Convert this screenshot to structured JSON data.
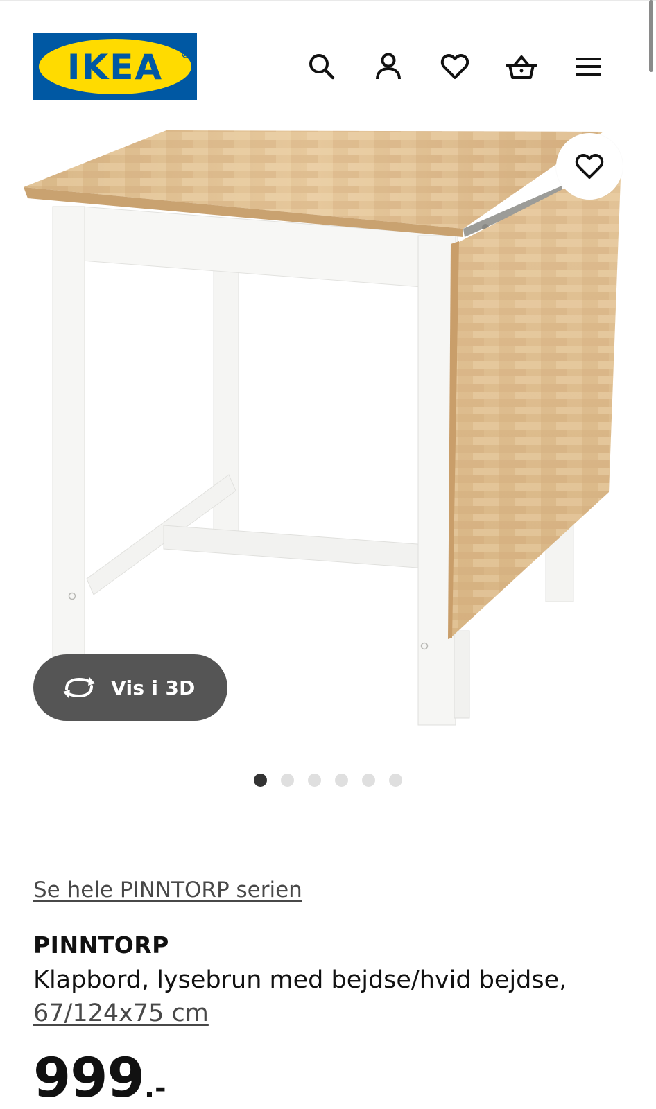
{
  "header": {
    "logo_text": "IKEA",
    "brand_colors": {
      "blue": "#0058a3",
      "yellow": "#ffdb00"
    },
    "icons": [
      "search-icon",
      "account-icon",
      "wishlist-heart-icon",
      "basket-icon",
      "menu-icon"
    ]
  },
  "gallery": {
    "favorite_icon": "heart-outline-icon",
    "view_3d_label": "Vis i 3D",
    "view_3d_icon": "rotate-3d-icon",
    "slide_count": 6,
    "active_slide": 1
  },
  "product": {
    "series_link": "Se hele PINNTORP serien",
    "name": "PINNTORP",
    "description": "Klapbord, lysebrun med bejdse/hvid bejdse,",
    "dimensions": "67/124x75 cm",
    "price_integer": "999",
    "price_suffix": ".-"
  }
}
